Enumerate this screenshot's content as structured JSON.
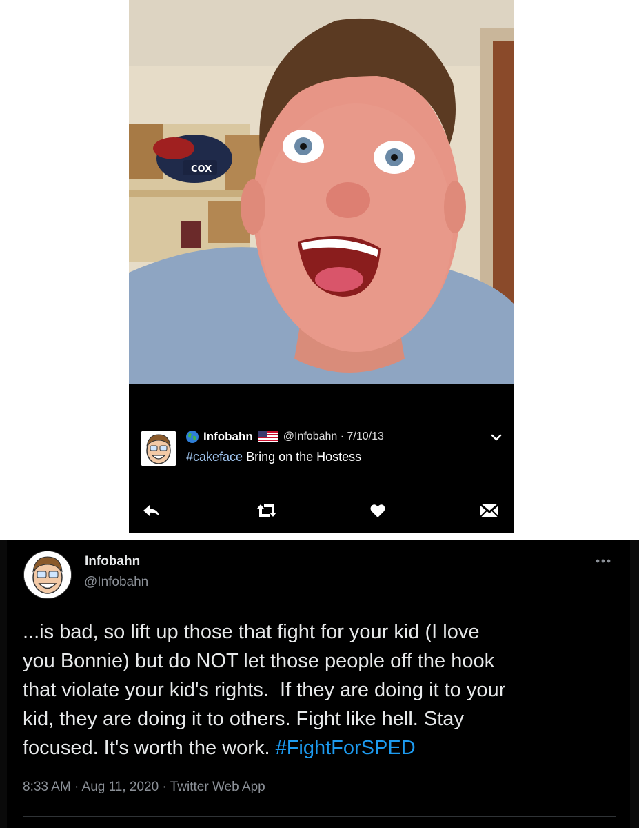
{
  "colors": {
    "background": "#ffffff",
    "tweet_bg": "#000000",
    "link_blue": "#1d9bf0",
    "old_hashtag": "#9fc4ee",
    "muted": "#8b9097"
  },
  "top_tweet": {
    "photo_sign_text": "COX",
    "display_name": "Infobahn",
    "handle_date": "@Infobahn · 7/10/13",
    "hashtag": "#cakeface",
    "text": " Bring on the Hostess",
    "icons": [
      "globe-icon",
      "flag-icon",
      "chevron-down-icon",
      "reply-icon",
      "retweet-icon",
      "like-icon",
      "dm-icon"
    ]
  },
  "bottom_tweet": {
    "display_name": "Infobahn",
    "handle": "@Infobahn",
    "lines": [
      "...is bad, so lift up those that fight for your kid (I love",
      "you Bonnie) but do NOT let those people off the hook",
      "that violate your kid's rights.  If they are doing it to your",
      "kid, they are doing it to others. Fight like hell. Stay"
    ],
    "last_line_text": "focused. It's worth the work. ",
    "hashtag": "#FightForSPED",
    "meta": "8:33 AM · Aug 11, 2020 · Twitter Web App",
    "icons": [
      "more-icon"
    ]
  }
}
